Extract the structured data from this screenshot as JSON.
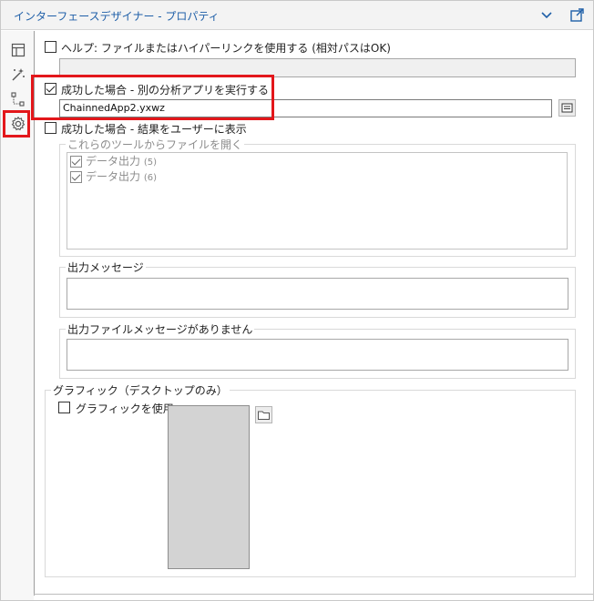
{
  "window": {
    "title": "インターフェースデザイナー - プロパティ"
  },
  "sidebar": {
    "icons": [
      "layout-icon",
      "magic-wand-icon",
      "tree-icon",
      "gear-icon"
    ],
    "selected": "gear-icon"
  },
  "help": {
    "label": "ヘルプ: ファイルまたはハイパーリンクを使用する (相対パスはOK)",
    "checked": false,
    "value": ""
  },
  "success_run": {
    "label": "成功した場合 - 別の分析アプリを実行する",
    "checked": true,
    "value": "ChainnedApp2.yxwz"
  },
  "success_show": {
    "label": "成功した場合 - 結果をユーザーに表示",
    "checked": false,
    "open_files": {
      "title": "これらのツールからファイルを開く",
      "items": [
        {
          "label": "データ出力",
          "count": "(5)",
          "checked": true
        },
        {
          "label": "データ出力",
          "count": "(6)",
          "checked": true
        }
      ]
    },
    "output_message": {
      "title": "出力メッセージ",
      "value": ""
    },
    "no_output_message": {
      "title": "出力ファイルメッセージがありません",
      "value": ""
    }
  },
  "graphic": {
    "title": "グラフィック（デスクトップのみ）",
    "use_label": "グラフィックを使用:",
    "checked": false
  },
  "colors": {
    "highlight": "#e3171b",
    "title_text": "#1f5fa8"
  }
}
